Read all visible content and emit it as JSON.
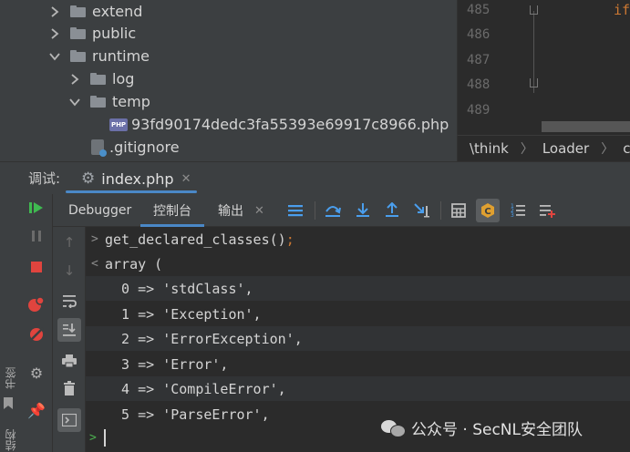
{
  "project_tree": {
    "items": [
      {
        "label": "extend",
        "type": "folder",
        "expanded": false
      },
      {
        "label": "public",
        "type": "folder",
        "expanded": false
      },
      {
        "label": "runtime",
        "type": "folder",
        "expanded": true
      },
      {
        "label": "log",
        "type": "folder",
        "expanded": false
      },
      {
        "label": "temp",
        "type": "folder",
        "expanded": true
      },
      {
        "label": "93fd90174dedc3fa55393e69917c8966.php",
        "type": "php-file"
      },
      {
        "label": ".gitignore",
        "type": "git-file"
      }
    ]
  },
  "editor": {
    "line_numbers": [
      "485",
      "486",
      "487",
      "488",
      "489"
    ],
    "visible_code_fragment": "if"
  },
  "breadcrumb": {
    "items": [
      "\\think",
      "Loader",
      "cor"
    ]
  },
  "debug": {
    "label": "调试:",
    "session_tab": "index.php",
    "tabs": [
      "Debugger",
      "控制台",
      "输出"
    ],
    "active_tab": "控制台"
  },
  "console": {
    "input": "get_declared_classes()",
    "input_terminator": ";",
    "output_header": "array (",
    "output_lines": [
      "  0 => 'stdClass',",
      "  1 => 'Exception',",
      "  2 => 'ErrorException',",
      "  3 => 'Error',",
      "  4 => 'CompileError',",
      "  5 => 'ParseError',"
    ]
  },
  "side_strip": {
    "bookmarks_label": "书签",
    "structure_label": "结构"
  },
  "watermark": {
    "text": "公众号 · SecNL安全团队"
  },
  "colors": {
    "accent": "#4a88c7",
    "panel": "#3c3f41",
    "editor_bg": "#2b2b2b",
    "resume_green": "#3fb950",
    "stop_red": "#e0443e",
    "keyword_orange": "#cc7832"
  }
}
